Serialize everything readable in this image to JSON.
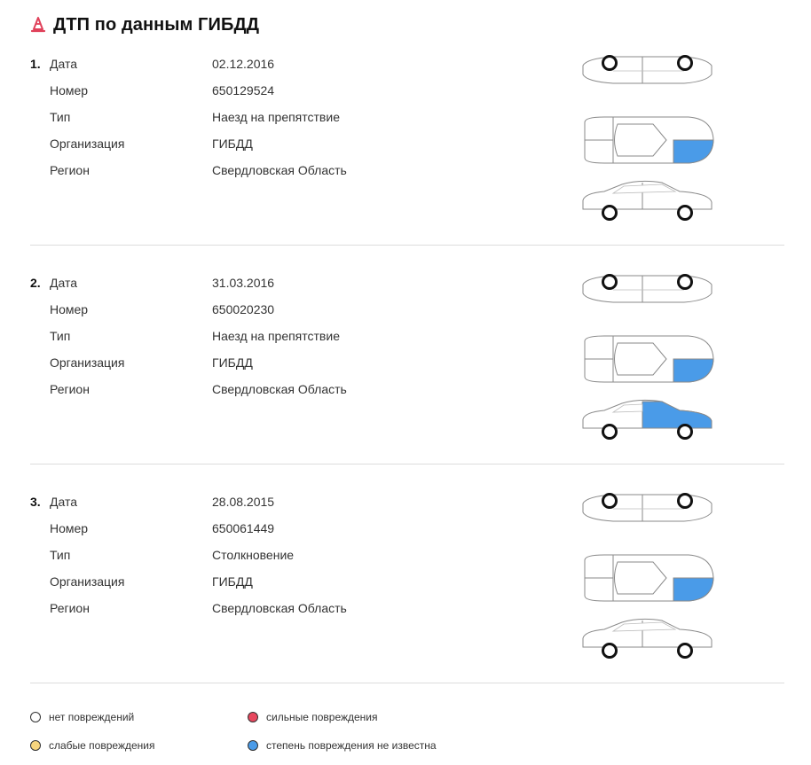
{
  "page": {
    "title": "ДТП по данным ГИБДД",
    "icon": "traffic-cone-icon",
    "accent_color": "#e0415a"
  },
  "records": [
    {
      "number": "1.",
      "fields": [
        {
          "label": "Дата",
          "value": "02.12.2016"
        },
        {
          "label": "Номер",
          "value": "650129524"
        },
        {
          "label": "Тип",
          "value": "Наезд на препятствие"
        },
        {
          "label": "Организация",
          "value": "ГИБДД"
        },
        {
          "label": "Регион",
          "value": "Свердловская Область"
        }
      ],
      "damage": {
        "top_rear": "unknown",
        "side_rear": "none"
      }
    },
    {
      "number": "2.",
      "fields": [
        {
          "label": "Дата",
          "value": "31.03.2016"
        },
        {
          "label": "Номер",
          "value": "650020230"
        },
        {
          "label": "Тип",
          "value": "Наезд на препятствие"
        },
        {
          "label": "Организация",
          "value": "ГИБДД"
        },
        {
          "label": "Регион",
          "value": "Свердловская Область"
        }
      ],
      "damage": {
        "top_rear": "unknown",
        "side_rear": "unknown"
      }
    },
    {
      "number": "3.",
      "fields": [
        {
          "label": "Дата",
          "value": "28.08.2015"
        },
        {
          "label": "Номер",
          "value": "650061449"
        },
        {
          "label": "Тип",
          "value": "Столкновение"
        },
        {
          "label": "Организация",
          "value": "ГИБДД"
        },
        {
          "label": "Регион",
          "value": "Свердловская Область"
        }
      ],
      "damage": {
        "top_rear": "unknown",
        "side_rear": "none"
      }
    }
  ],
  "legend": [
    {
      "label": "нет повреждений",
      "color": "#ffffff"
    },
    {
      "label": "сильные повреждения",
      "color": "#e8475e"
    },
    {
      "label": "слабые повреждения",
      "color": "#f7d57e"
    },
    {
      "label": "степень повреждения не известна",
      "color": "#4a9be8"
    }
  ],
  "colors": {
    "none": "#ffffff",
    "unknown": "#4a9be8",
    "outline": "#8a8a8a",
    "divider": "#dcdcdc"
  }
}
